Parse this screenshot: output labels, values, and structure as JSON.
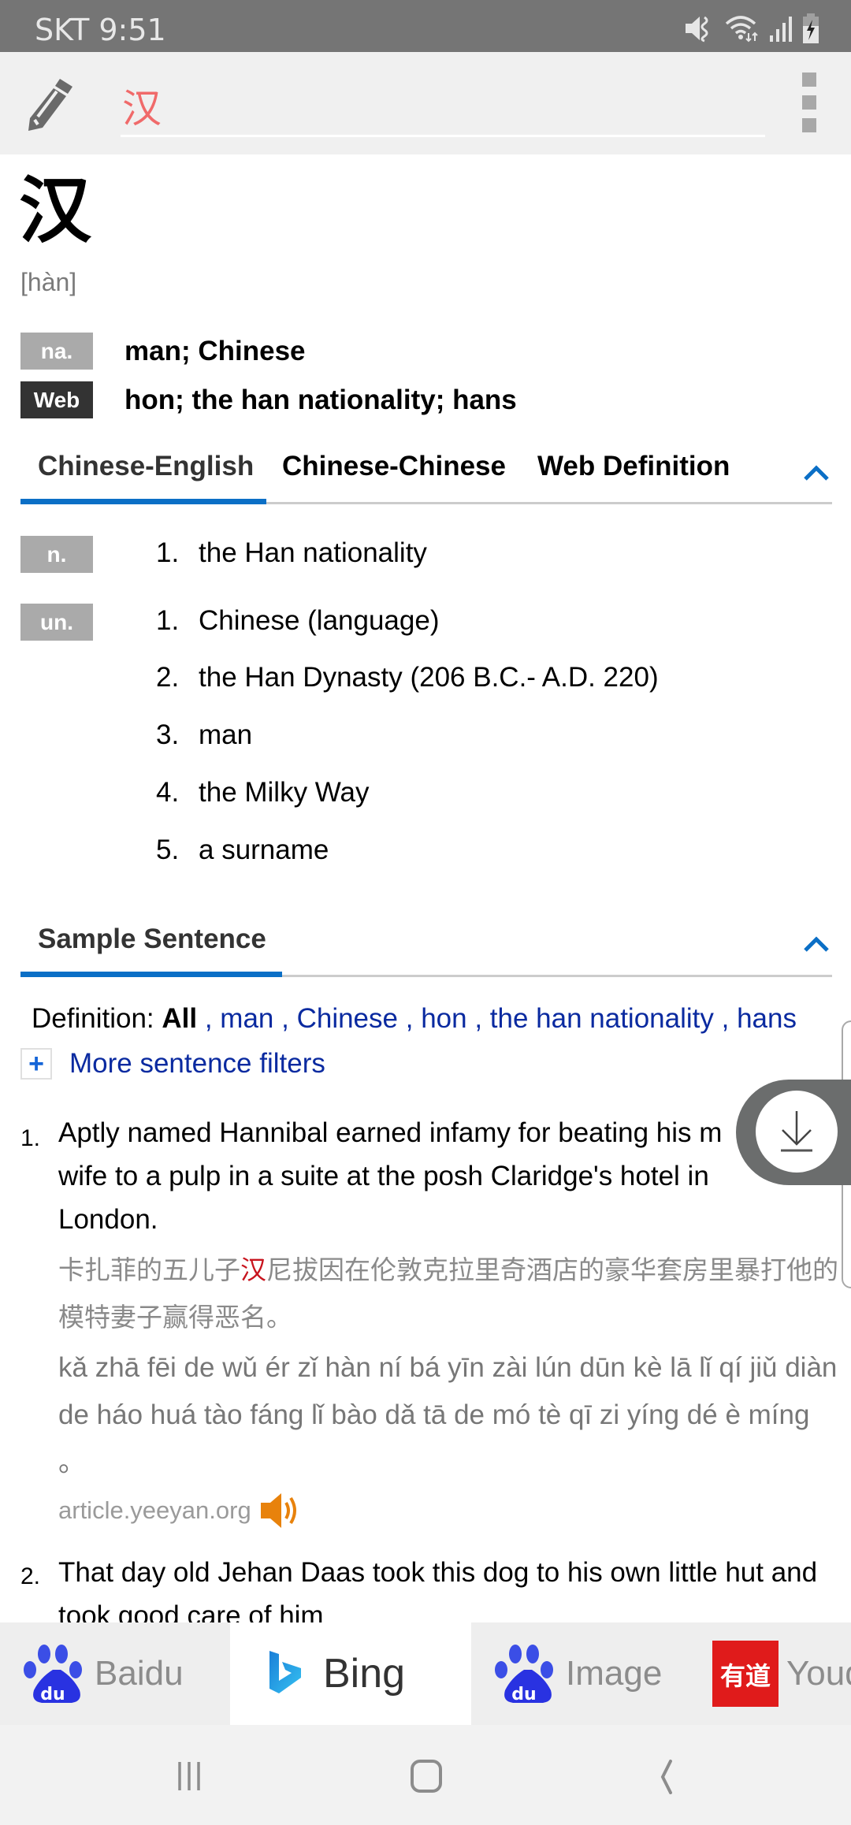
{
  "status_bar": {
    "carrier_time": "SKT 9:51",
    "icons": [
      "mute-vibrate-icon",
      "wifi-icon",
      "signal-icon",
      "battery-charging-icon"
    ]
  },
  "app_bar": {
    "edit_icon": "pencil-icon",
    "search_value": "汉",
    "search_color": "#f06a6a",
    "more_icon": "more-vertical-icon"
  },
  "entry": {
    "headword": "汉",
    "pinyin": "[hàn]",
    "summary": [
      {
        "tag": "na.",
        "text": "man; Chinese"
      },
      {
        "tag": "Web",
        "text": "hon; the han nationality; hans"
      }
    ]
  },
  "tabs": {
    "items": [
      {
        "label": "Chinese-English",
        "active": true
      },
      {
        "label": "Chinese-Chinese",
        "active": false
      },
      {
        "label": "Web Definition",
        "active": false
      }
    ],
    "accent": "#0b6fc6"
  },
  "definitions": [
    {
      "tag": "n.",
      "items": [
        {
          "num": "1.",
          "text": "the Han nationality"
        }
      ]
    },
    {
      "tag": "un.",
      "items": [
        {
          "num": "1.",
          "text": "Chinese (language)"
        },
        {
          "num": "2.",
          "text": "the Han Dynasty (206 B.C.- A.D. 220)"
        },
        {
          "num": "3.",
          "text": "man"
        },
        {
          "num": "4.",
          "text": "the Milky Way"
        },
        {
          "num": "5.",
          "text": "a surname"
        }
      ]
    }
  ],
  "sample_sentence": {
    "title": "Sample Sentence",
    "filter_label": "Definition:",
    "filter_all": "All",
    "filters": [
      "man",
      "Chinese",
      "hon",
      "the han nationality",
      "hans"
    ],
    "more_filters": "More sentence filters",
    "sentences": [
      {
        "num": "1.",
        "en": "Aptly named Hannibal earned infamy for beating his model wife to a pulp in a suite at the posh Claridge's hotel in London.",
        "en_visible_line1": "Aptly named Hannibal earned infamy for beating his m",
        "en_visible_rest": "wife to a pulp in a suite at the posh Claridge's hotel in London.",
        "zh_before": "卡扎菲的五儿子",
        "zh_highlight": "汉",
        "zh_after": "尼拔因在伦敦克拉里奇酒店的豪华套房里暴打他的模特妻子赢得恶名。",
        "pinyin": "kǎ zhā fēi de wǔ ér zǐ hàn ní bá yīn zài lún dūn kè lā lǐ qí jiǔ diàn de háo huá tào fáng lǐ bào dǎ tā de mó tè qī zi yíng dé è míng 。",
        "source": "article.yeeyan.org"
      },
      {
        "num": "2.",
        "en": "That day old Jehan Daas took this dog to his own little hut and took good care of him"
      }
    ]
  },
  "floating_button": {
    "icon": "download-icon"
  },
  "engines": [
    {
      "label": "Baidu",
      "icon": "baidu-paw-icon",
      "active": false
    },
    {
      "label": "Bing",
      "icon": "bing-logo-icon",
      "active": true
    },
    {
      "label": "Image",
      "icon": "baidu-paw-icon",
      "active": false
    },
    {
      "label": "Youdao",
      "icon": "youdao-logo-icon",
      "active": false
    }
  ],
  "nav_bar": {
    "buttons": [
      "recent-apps-icon",
      "home-icon",
      "back-icon"
    ]
  }
}
